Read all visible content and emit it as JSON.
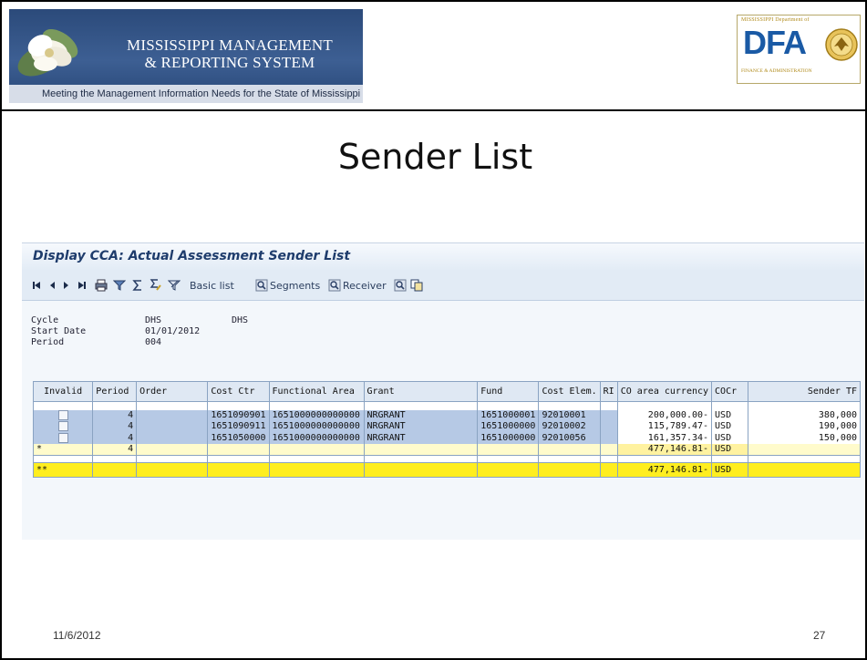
{
  "banner": {
    "system_name_line1": "MISSISSIPPI MANAGEMENT",
    "system_name_line2": "& REPORTING SYSTEM",
    "tagline": "Meeting the Management Information Needs for the State of Mississippi"
  },
  "dfa_logo": {
    "top_text": "MISSISSIPPI Department of",
    "letters": "DFA",
    "bottom_text": "FINANCE & ADMINISTRATION"
  },
  "slide": {
    "title": "Sender List",
    "date": "11/6/2012",
    "page_number": "27"
  },
  "sap": {
    "window_title": "Display CCA: Actual Assessment Sender List",
    "toolbar": {
      "icons": [
        "first-page-icon",
        "previous-page-icon",
        "next-page-icon",
        "last-page-icon",
        "print-icon",
        "filter-icon",
        "sum-icon",
        "subtotal-icon",
        "filter-off-icon"
      ],
      "basic_list": "Basic list",
      "segments": "Segments",
      "receiver": "Receiver"
    },
    "info": {
      "cycle_label": "Cycle",
      "cycle_value": "DHS",
      "cycle_value2": "DHS",
      "start_date_label": "Start Date",
      "start_date_value": "01/01/2012",
      "period_label": "Period",
      "period_value": "004"
    },
    "grid": {
      "headers": [
        "Invalid",
        "Period",
        "Order",
        "Cost Ctr",
        "Functional Area",
        "Grant",
        "Fund",
        "Cost Elem.",
        "RI",
        "CO area currency",
        "COCr",
        "Sender TF"
      ],
      "rows": [
        {
          "period": "4",
          "order": "",
          "cost_ctr": "1651090901",
          "functional_area": "1651000000000000",
          "grant": "NRGRANT",
          "fund": "1651000001",
          "cost_elem": "92010001",
          "ri": "",
          "amount": "200,000.00-",
          "cocr": "USD",
          "sender_tf": "380,000"
        },
        {
          "period": "4",
          "order": "",
          "cost_ctr": "1651090911",
          "functional_area": "1651000000000000",
          "grant": "NRGRANT",
          "fund": "1651000000",
          "cost_elem": "92010002",
          "ri": "",
          "amount": "115,789.47-",
          "cocr": "USD",
          "sender_tf": "190,000"
        },
        {
          "period": "4",
          "order": "",
          "cost_ctr": "1651050000",
          "functional_area": "1651000000000000",
          "grant": "NRGRANT",
          "fund": "1651000000",
          "cost_elem": "92010056",
          "ri": "",
          "amount": "161,357.34-",
          "cocr": "USD",
          "sender_tf": "150,000"
        }
      ],
      "subtotal": {
        "marker": "*",
        "period": "4",
        "amount": "477,146.81-",
        "cocr": "USD"
      },
      "total": {
        "marker": "**",
        "amount": "477,146.81-",
        "cocr": "USD"
      }
    }
  }
}
